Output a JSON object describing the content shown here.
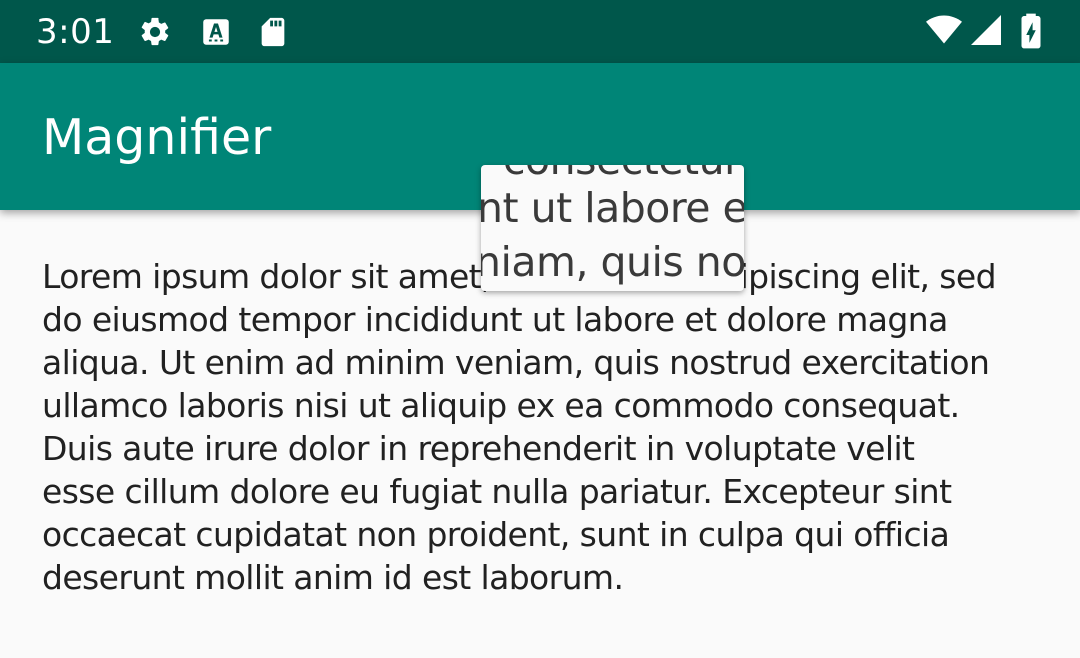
{
  "status_bar": {
    "time": "3:01",
    "icons": [
      "settings-gear-icon",
      "accessibility-a-icon",
      "sd-card-icon",
      "wifi-icon",
      "cell-signal-icon",
      "battery-charging-icon"
    ],
    "background": "#00574b"
  },
  "app_bar": {
    "title": "Magnifier",
    "background": "#008577"
  },
  "content": {
    "paragraph_lines": [
      "Lorem ipsum dolor sit amet, consectetur adipiscing elit, sed",
      "do eiusmod tempor incididunt ut labore et dolore magna",
      "aliqua. Ut enim ad minim veniam, quis nostrud exercitation",
      "ullamco laboris nisi ut aliquip ex ea commodo consequat.",
      "Duis aute irure dolor in reprehenderit in voluptate velit",
      "esse cillum dolore eu fugiat nulla pariatur. Excepteur sint",
      "occaecat cupidatat non proident, sunt in culpa qui officia",
      "deserunt mollit anim id est laborum."
    ]
  },
  "magnifier": {
    "lines": [
      "consectetur",
      "nt ut labore et",
      "niam, quis nos"
    ]
  }
}
